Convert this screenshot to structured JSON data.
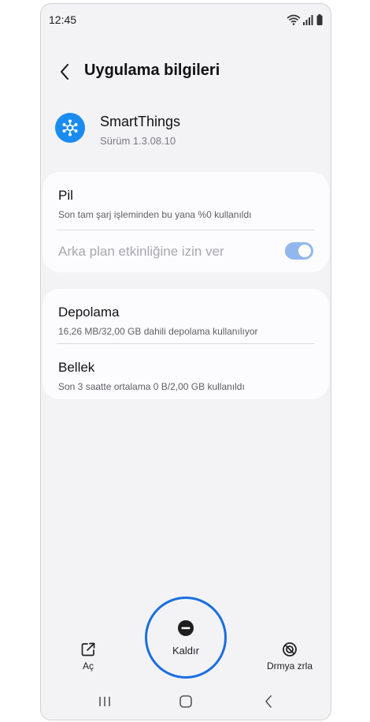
{
  "status_bar": {
    "time": "12:45"
  },
  "header": {
    "title": "Uygulama bilgileri"
  },
  "app": {
    "name": "SmartThings",
    "version": "Sürüm 1.3.08.10",
    "icon": "smartthings-icon",
    "icon_color": "#1a8cf0"
  },
  "battery_card": {
    "title": "Pil",
    "subtitle": "Son tam şarj işleminden bu yana %0 kullanıldı",
    "background_toggle_label": "Arka plan etkinliğine izin ver",
    "background_toggle_on": true
  },
  "storage_card": {
    "storage_title": "Depolama",
    "storage_subtitle": "16,26 MB/32,00 GB dahili depolama kullanılıyor",
    "memory_title": "Bellek",
    "memory_subtitle": "Son 3 saatte ortalama 0 B/2,00 GB kullanıldı"
  },
  "actions": {
    "open_label": "Aç",
    "uninstall_label": "Kaldır",
    "force_stop_label": "Drmya zrla"
  },
  "colors": {
    "accent": "#1a6fe0",
    "toggle": "#92b7ef",
    "background": "#f3f3f6",
    "card": "#fcfcfe"
  }
}
